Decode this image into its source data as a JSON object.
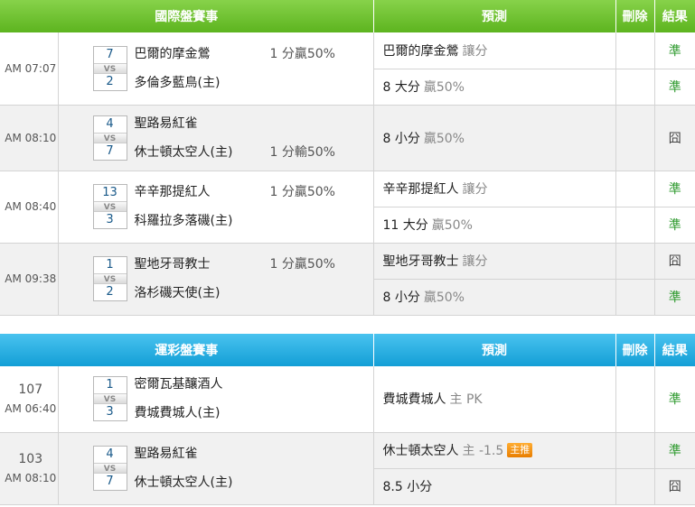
{
  "intl": {
    "header": {
      "title": "國際盤賽事",
      "prediction": "預測",
      "delete": "刪除",
      "result": "結果"
    },
    "matches": [
      {
        "time": "AM 07:07",
        "away_score": "7",
        "home_score": "2",
        "away": "巴爾的摩金鶯",
        "home": "多倫多藍鳥(主)",
        "away_hc": "1 分贏50%",
        "home_hc": "",
        "predictions": [
          {
            "pick": "巴爾的摩金鶯",
            "sub": "讓分",
            "result": "準",
            "win": true
          },
          {
            "pick": "8 大分",
            "sub": "贏50%",
            "result": "準",
            "win": true
          }
        ]
      },
      {
        "time": "AM 08:10",
        "away_score": "4",
        "home_score": "7",
        "away": "聖路易紅雀",
        "home": "休士頓太空人(主)",
        "away_hc": "",
        "home_hc": "1 分輸50%",
        "predictions": [
          {
            "pick": "8 小分",
            "sub": "贏50%",
            "result": "囧",
            "win": false
          }
        ]
      },
      {
        "time": "AM 08:40",
        "away_score": "13",
        "home_score": "3",
        "away": "辛辛那提紅人",
        "home": "科羅拉多落磯(主)",
        "away_hc": "1 分贏50%",
        "home_hc": "",
        "predictions": [
          {
            "pick": "辛辛那提紅人",
            "sub": "讓分",
            "result": "準",
            "win": true
          },
          {
            "pick": "11 大分",
            "sub": "贏50%",
            "result": "準",
            "win": true
          }
        ]
      },
      {
        "time": "AM 09:38",
        "away_score": "1",
        "home_score": "2",
        "away": "聖地牙哥教士",
        "home": "洛杉磯天使(主)",
        "away_hc": "1 分贏50%",
        "home_hc": "",
        "predictions": [
          {
            "pick": "聖地牙哥教士",
            "sub": "讓分",
            "result": "囧",
            "win": false
          },
          {
            "pick": "8 小分",
            "sub": "贏50%",
            "result": "準",
            "win": true
          }
        ]
      }
    ]
  },
  "lottery": {
    "header": {
      "title": "運彩盤賽事",
      "prediction": "預測",
      "delete": "刪除",
      "result": "結果"
    },
    "matches": [
      {
        "num": "107",
        "time": "AM 06:40",
        "away_score": "1",
        "home_score": "3",
        "away": "密爾瓦基釀酒人",
        "home": "費城費城人(主)",
        "predictions": [
          {
            "pick": "費城費城人",
            "sub": "主 PK",
            "badge": "",
            "result": "準",
            "win": true
          }
        ]
      },
      {
        "num": "103",
        "time": "AM 08:10",
        "away_score": "4",
        "home_score": "7",
        "away": "聖路易紅雀",
        "home": "休士頓太空人(主)",
        "predictions": [
          {
            "pick": "休士頓太空人",
            "sub": "主 -1.5",
            "badge": "主推",
            "result": "準",
            "win": true
          },
          {
            "pick": "8.5 小分",
            "sub": "",
            "badge": "",
            "result": "囧",
            "win": false
          }
        ]
      }
    ]
  },
  "colors": {
    "win": "#2e9a2e",
    "lose": "#444444",
    "intl_header": "#6cc22e",
    "lottery_header": "#1fb0e4"
  }
}
